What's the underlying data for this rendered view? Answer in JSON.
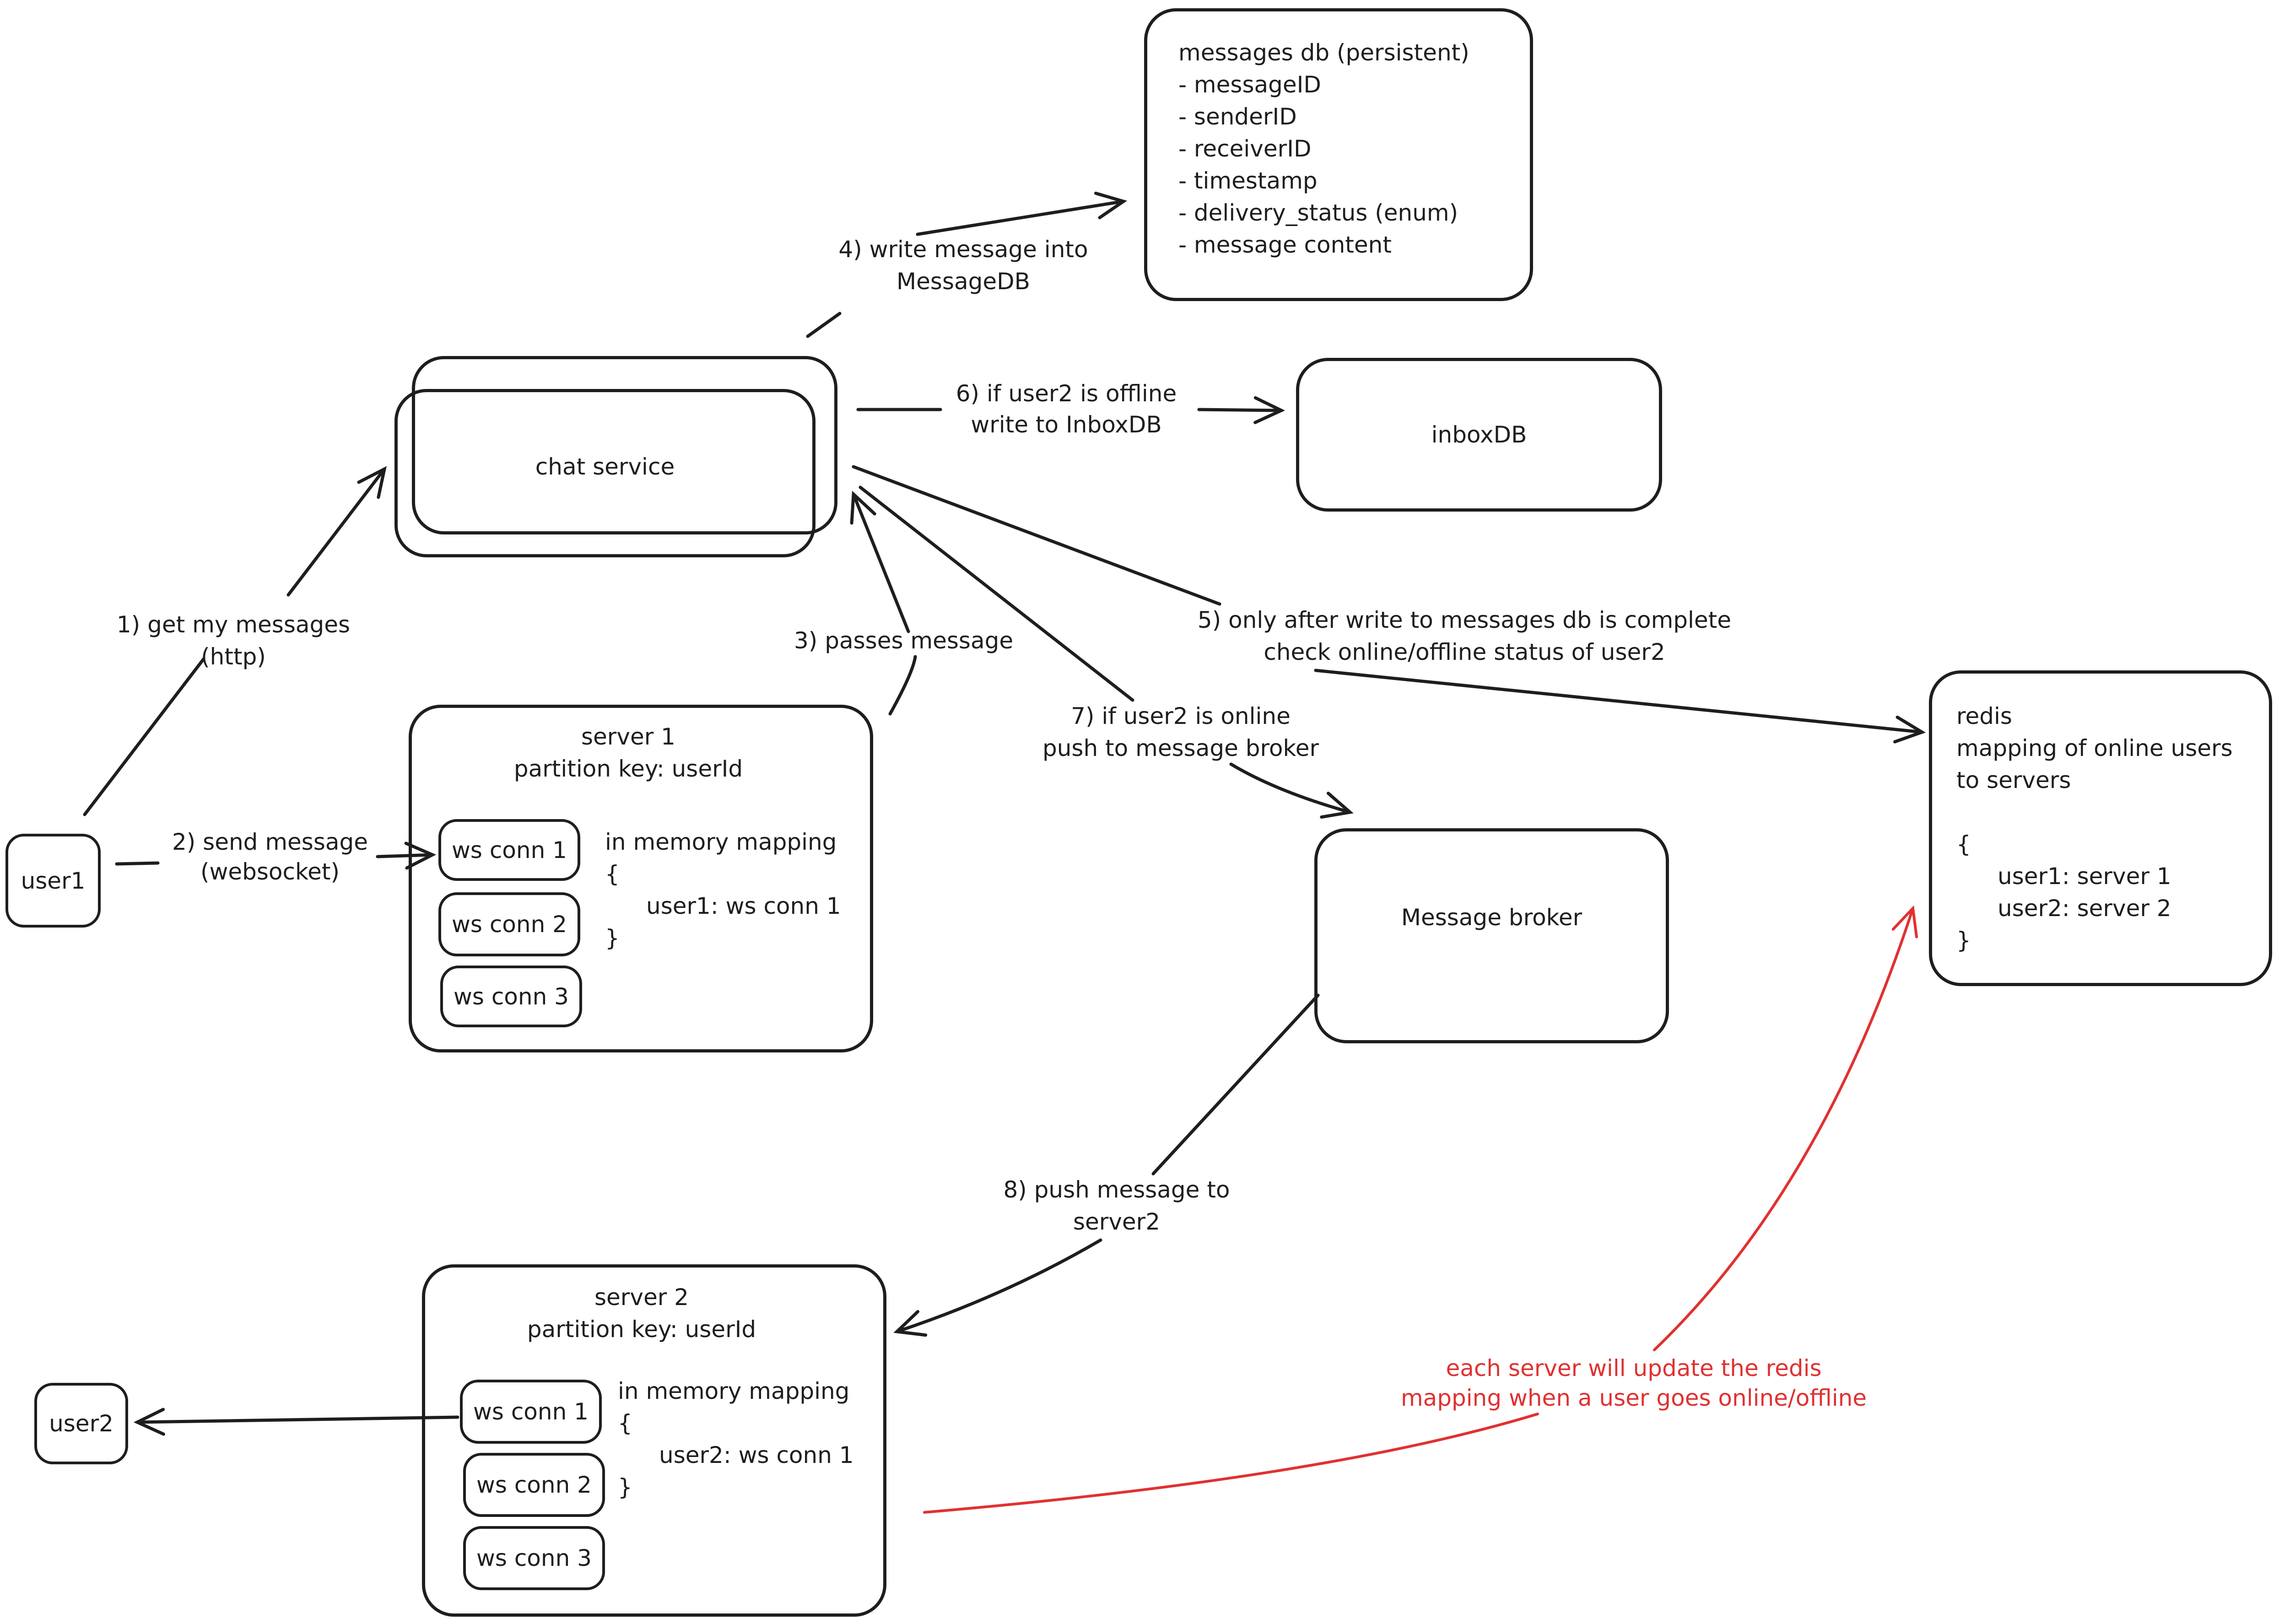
{
  "nodes": {
    "messages_db": {
      "title": "messages db (persistent)",
      "fields": [
        "- messageID",
        "- senderID",
        "- receiverID",
        "- timestamp",
        "- delivery_status (enum)",
        "- message content"
      ]
    },
    "chat_service": {
      "label": "chat service"
    },
    "inbox_db": {
      "label": "inboxDB"
    },
    "message_broker": {
      "label": "Message broker"
    },
    "redis": {
      "title": "redis",
      "description_line1": "mapping of online users",
      "description_line2": "to servers",
      "open_brace": "{",
      "entries": [
        "user1: server 1",
        "user2: server 2"
      ],
      "close_brace": "}"
    },
    "user1": {
      "label": "user1"
    },
    "user2": {
      "label": "user2"
    },
    "server1": {
      "title": "server 1",
      "partition": "partition key: userId",
      "connections": [
        "ws conn 1",
        "ws conn 2",
        "ws conn 3"
      ],
      "mapping_title": "in memory mapping",
      "open_brace": "{",
      "mapping_entry": "user1: ws conn 1",
      "close_brace": "}"
    },
    "server2": {
      "title": "server 2",
      "partition": "partition key: userId",
      "connections": [
        "ws conn 1",
        "ws conn 2",
        "ws conn 3"
      ],
      "mapping_title": "in memory mapping",
      "open_brace": "{",
      "mapping_entry": "user2: ws conn 1",
      "close_brace": "}"
    }
  },
  "edges": {
    "step1": {
      "line1": "1) get my messages",
      "line2": "(http)"
    },
    "step2": {
      "line1": "2) send message",
      "line2": "(websocket)"
    },
    "step3": {
      "line1": "3) passes message"
    },
    "step4": {
      "line1": "4) write message into",
      "line2": "MessageDB"
    },
    "step5": {
      "line1": "5) only after write to messages db is complete",
      "line2": "check online/offline status of user2"
    },
    "step6": {
      "line1": "6) if user2 is offline",
      "line2": "write to InboxDB"
    },
    "step7": {
      "line1": "7) if user2 is online",
      "line2": "push to message broker"
    },
    "step8": {
      "line1": "8) push message to",
      "line2": "server2"
    }
  },
  "annotation": {
    "line1": "each server will update the redis",
    "line2": "mapping when a user goes online/offline",
    "color": "#e03131"
  },
  "colors": {
    "stroke": "#1e1e1e",
    "background": "#ffffff"
  }
}
